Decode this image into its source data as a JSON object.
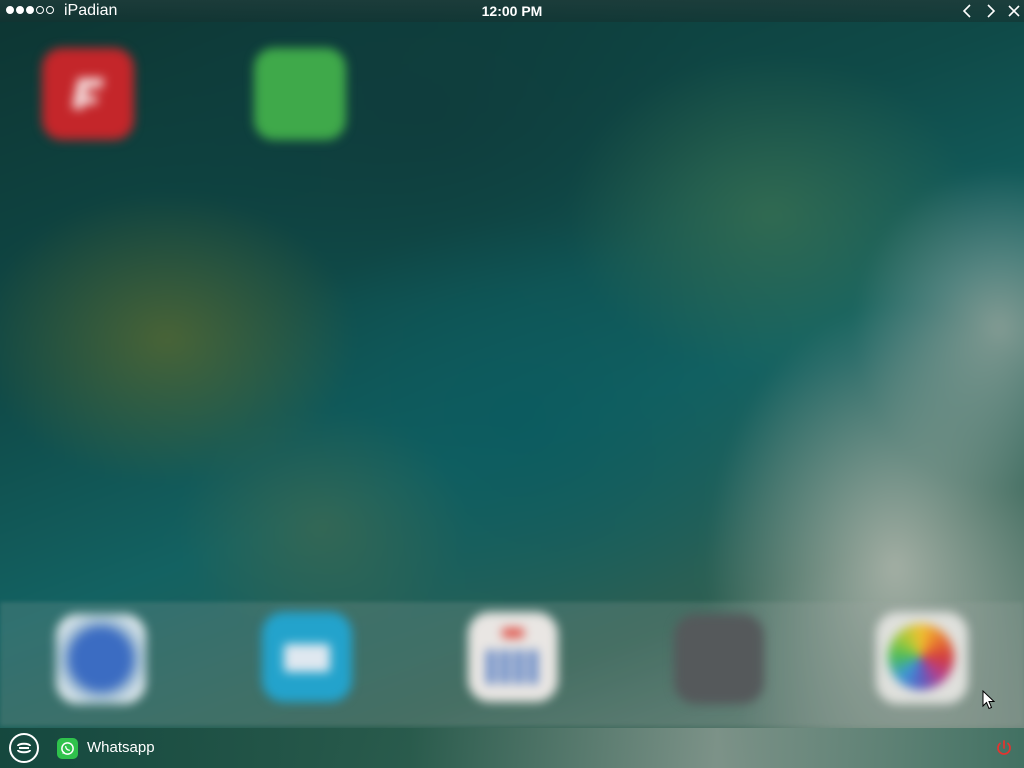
{
  "status_bar": {
    "signal_dots": [
      true,
      true,
      true,
      false,
      false
    ],
    "carrier": "iPadian",
    "time": "12:00 PM"
  },
  "window_controls": {
    "back_icon": "chevron-left-icon",
    "forward_icon": "chevron-right-icon",
    "close_icon": "close-icon"
  },
  "home_screen": {
    "apps": [
      {
        "icon": "red-app-icon",
        "color": "#c4262a"
      },
      {
        "icon": "green-app-icon",
        "color": "#3fa94a"
      }
    ]
  },
  "dock": {
    "apps": [
      {
        "icon": "safari-icon",
        "color": "#3d6fbe"
      },
      {
        "icon": "mail-icon",
        "color": "#2aa0cf"
      },
      {
        "icon": "calendar-icon",
        "color": "#e8e6e4"
      },
      {
        "icon": "settings-icon",
        "color": "#5b5e60"
      },
      {
        "icon": "photos-icon",
        "color": "#f0b93a"
      }
    ]
  },
  "taskbar": {
    "start_icon": "ipadian-logo-icon",
    "running_apps": [
      {
        "label": "Whatsapp",
        "icon": "whatsapp-icon",
        "color": "#2fc24c"
      }
    ],
    "power_icon": "power-icon",
    "power_color": "#e3342f"
  }
}
